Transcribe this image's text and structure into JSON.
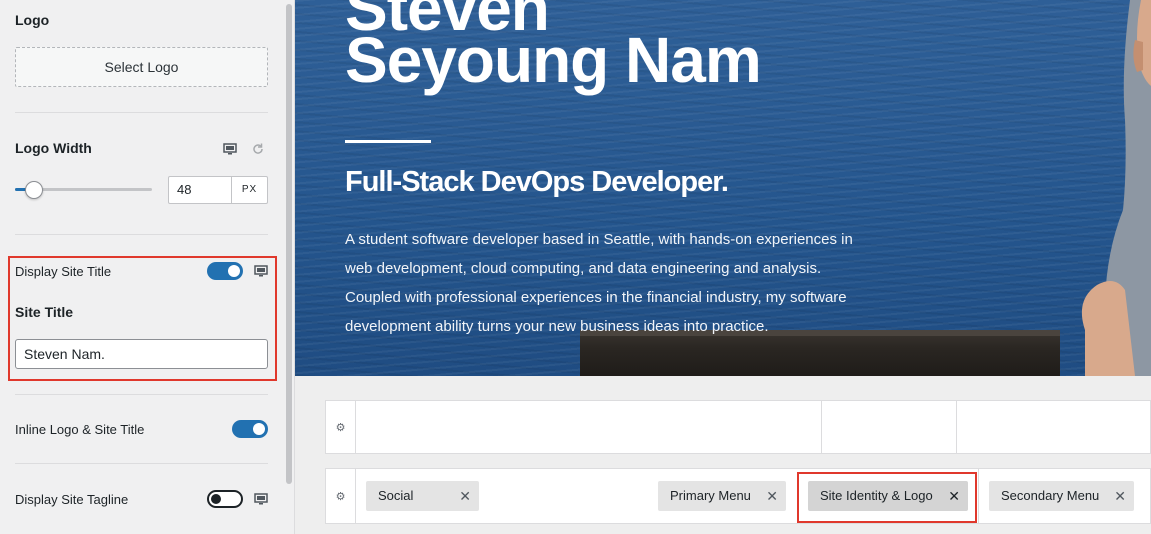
{
  "panel": {
    "logo": {
      "title": "Logo",
      "select_button": "Select Logo"
    },
    "logo_width": {
      "title": "Logo Width",
      "device_icon": "desktop-icon",
      "reset_icon": "reset-icon",
      "value": "48",
      "unit": "PX",
      "slider_fraction": 0.14
    },
    "display_site_title": {
      "label": "Display Site Title",
      "enabled": true
    },
    "site_title": {
      "heading": "Site Title",
      "value": "Steven Nam."
    },
    "inline_logo": {
      "label": "Inline Logo & Site Title",
      "enabled": true
    },
    "display_tagline": {
      "label": "Display Site Tagline",
      "enabled": false
    }
  },
  "hero": {
    "name_line1": "Steven",
    "name_line2": "Seyoung Nam",
    "subtitle": "Full-Stack DevOps Developer.",
    "body": "A student software developer based in Seattle, with hands-on experiences in web development, cloud computing, and data engineering and analysis. Coupled with professional experiences in the financial industry, my software development ability turns your new business ideas into practice."
  },
  "builder": {
    "gear_icon": "gear-icon",
    "chips": [
      {
        "label": "Social"
      },
      {
        "label": "Primary Menu"
      },
      {
        "label": "Site Identity & Logo"
      },
      {
        "label": "Secondary Menu"
      }
    ],
    "remove_glyph": "✕"
  },
  "colors": {
    "accent": "#2271b1",
    "highlight": "#e0382c"
  }
}
